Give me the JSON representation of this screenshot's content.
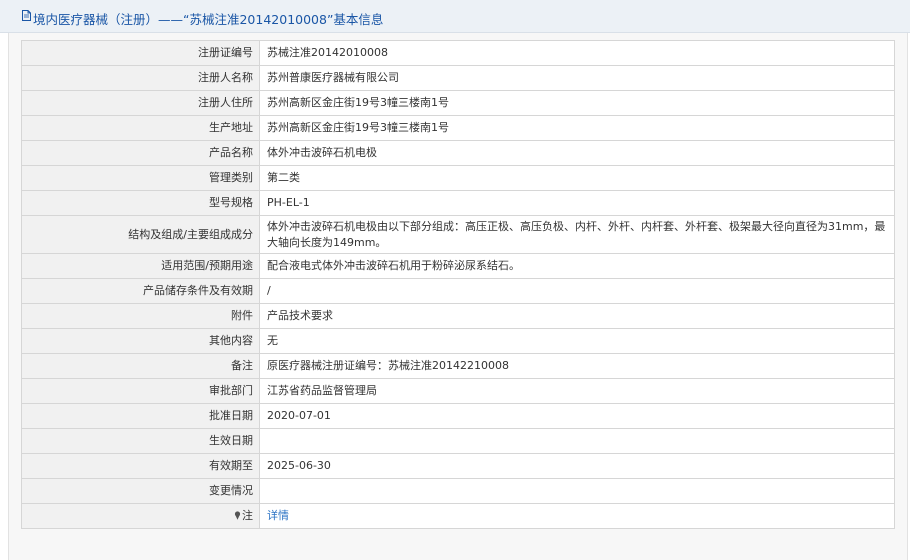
{
  "header": {
    "title": "境内医疗器械（注册）——“苏械注准20142010008”基本信息",
    "icon": "document-icon"
  },
  "colors": {
    "header_bg": "#ecf1f6",
    "title": "#1a56a6",
    "label_bg": "#f1f1f1",
    "border": "#d6d6d6",
    "link": "#2b73c4"
  },
  "rows": [
    {
      "name": "registration-number",
      "label": "注册证编号",
      "value": "苏械注准20142010008"
    },
    {
      "name": "registrant-name",
      "label": "注册人名称",
      "value": "苏州普康医疗器械有限公司"
    },
    {
      "name": "registrant-address",
      "label": "注册人住所",
      "value": "苏州高新区金庄街19号3幢三楼南1号"
    },
    {
      "name": "production-address",
      "label": "生产地址",
      "value": "苏州高新区金庄街19号3幢三楼南1号"
    },
    {
      "name": "product-name",
      "label": "产品名称",
      "value": "体外冲击波碎石机电极"
    },
    {
      "name": "management-category",
      "label": "管理类别",
      "value": "第二类"
    },
    {
      "name": "model-spec",
      "label": "型号规格",
      "value": "PH-EL-1"
    },
    {
      "name": "structure-composition",
      "label": "结构及组成/主要组成成分",
      "value": "体外冲击波碎石机电极由以下部分组成：高压正极、高压负极、内杆、外杆、内杆套、外杆套、极架最大径向直径为31mm，最大轴向长度为149mm。"
    },
    {
      "name": "intended-use",
      "label": "适用范围/预期用途",
      "value": "配合液电式体外冲击波碎石机用于粉碎泌尿系结石。"
    },
    {
      "name": "storage-conditions",
      "label": "产品储存条件及有效期",
      "value": "/"
    },
    {
      "name": "attachment",
      "label": "附件",
      "value": "产品技术要求"
    },
    {
      "name": "other-content",
      "label": "其他内容",
      "value": "无"
    },
    {
      "name": "remarks",
      "label": "备注",
      "value": "原医疗器械注册证编号：苏械注准20142210008"
    },
    {
      "name": "approval-department",
      "label": "审批部门",
      "value": "江苏省药品监督管理局"
    },
    {
      "name": "approval-date",
      "label": "批准日期",
      "value": "2020-07-01"
    },
    {
      "name": "effective-date",
      "label": "生效日期",
      "value": ""
    },
    {
      "name": "valid-until",
      "label": "有效期至",
      "value": "2025-06-30"
    },
    {
      "name": "change-info",
      "label": "变更情况",
      "value": ""
    }
  ],
  "note": {
    "label": "注",
    "icon": "pin-icon",
    "link_text": "详情"
  }
}
